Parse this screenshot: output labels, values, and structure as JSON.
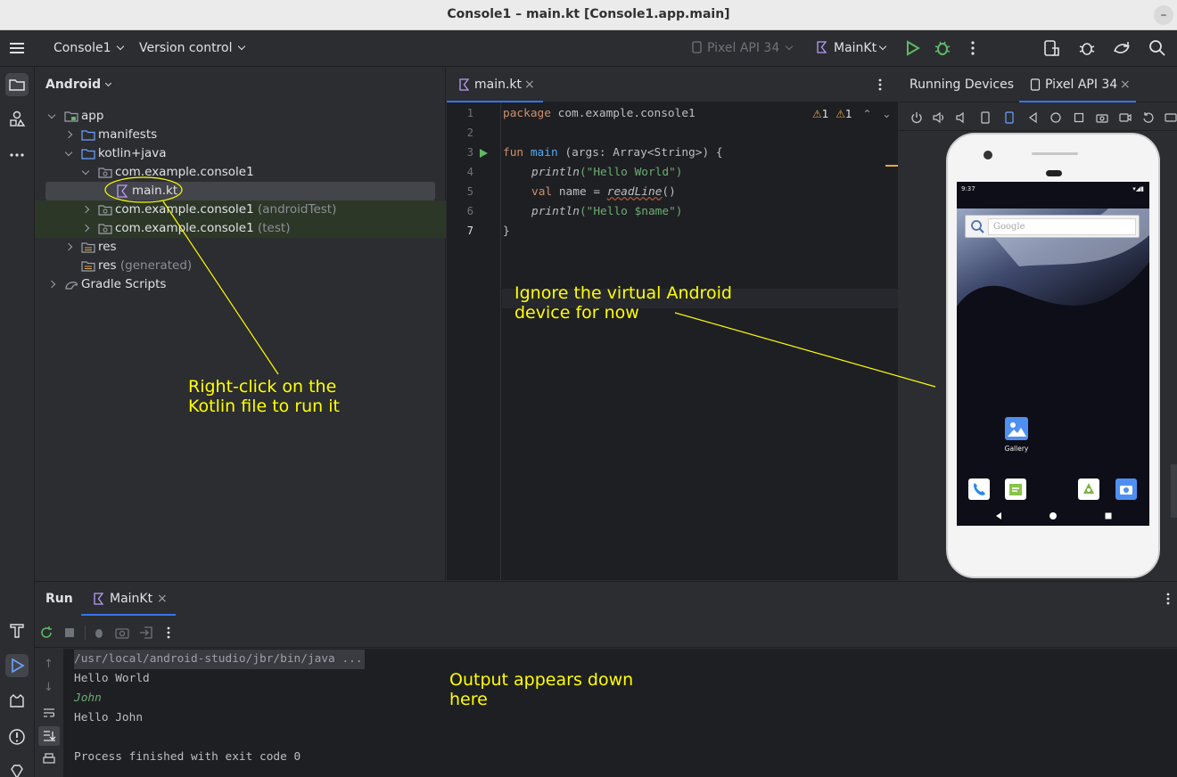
{
  "window": {
    "title": "Console1 – main.kt [Console1.app.main]"
  },
  "toolbar": {
    "project": "Console1",
    "vcs": "Version control",
    "device": "Pixel API 34",
    "run_config": "MainKt"
  },
  "project_panel": {
    "view": "Android",
    "tree": [
      {
        "label": "app",
        "suffix": ""
      },
      {
        "label": "manifests",
        "suffix": ""
      },
      {
        "label": "kotlin+java",
        "suffix": ""
      },
      {
        "label": "com.example.console1",
        "suffix": ""
      },
      {
        "label": "main.kt",
        "suffix": ""
      },
      {
        "label": "com.example.console1",
        "suffix": "(androidTest)"
      },
      {
        "label": "com.example.console1",
        "suffix": "(test)"
      },
      {
        "label": "res",
        "suffix": ""
      },
      {
        "label": "res",
        "suffix": "(generated)"
      },
      {
        "label": "Gradle Scripts",
        "suffix": ""
      }
    ]
  },
  "editor": {
    "tab": "main.kt",
    "warnings": [
      "1",
      "1"
    ],
    "line_numbers": [
      "1",
      "2",
      "3",
      "4",
      "5",
      "6",
      "7"
    ],
    "code": {
      "l1_kw": "package",
      "l1_rest": " com.example.console1",
      "l3_kw": "fun",
      "l3_fn": "main",
      "l3_rest": " (args: Array<String>) {",
      "l4_fn": "println",
      "l4_str": "(\"Hello World\")",
      "l5_kw": "val",
      "l5_rest": " name = ",
      "l5_fn": "readLine",
      "l5_end": "()",
      "l6_fn": "println",
      "l6_str": "(\"Hello $name\")",
      "l7": "}"
    }
  },
  "devices_panel": {
    "title": "Running Devices",
    "tab": "Pixel API 34",
    "phone": {
      "time": "9:37",
      "search_placeholder": "Google",
      "gallery_label": "Gallery"
    }
  },
  "run_panel": {
    "title": "Run",
    "tab": "MainKt",
    "console": [
      "/usr/local/android-studio/jbr/bin/java ...",
      "Hello World",
      "John",
      "Hello John",
      "",
      "Process finished with exit code 0"
    ]
  },
  "annotations": {
    "right_click_l1": "Right-click on the",
    "right_click_l2": "Kotlin file to run it",
    "ignore_l1": "Ignore the virtual Android",
    "ignore_l2": "device for now",
    "output_l1": "Output appears down",
    "output_l2": "here"
  },
  "colors": {
    "accent": "#3574f0",
    "annotation": "#ffff00",
    "run_green": "#5fb865"
  }
}
